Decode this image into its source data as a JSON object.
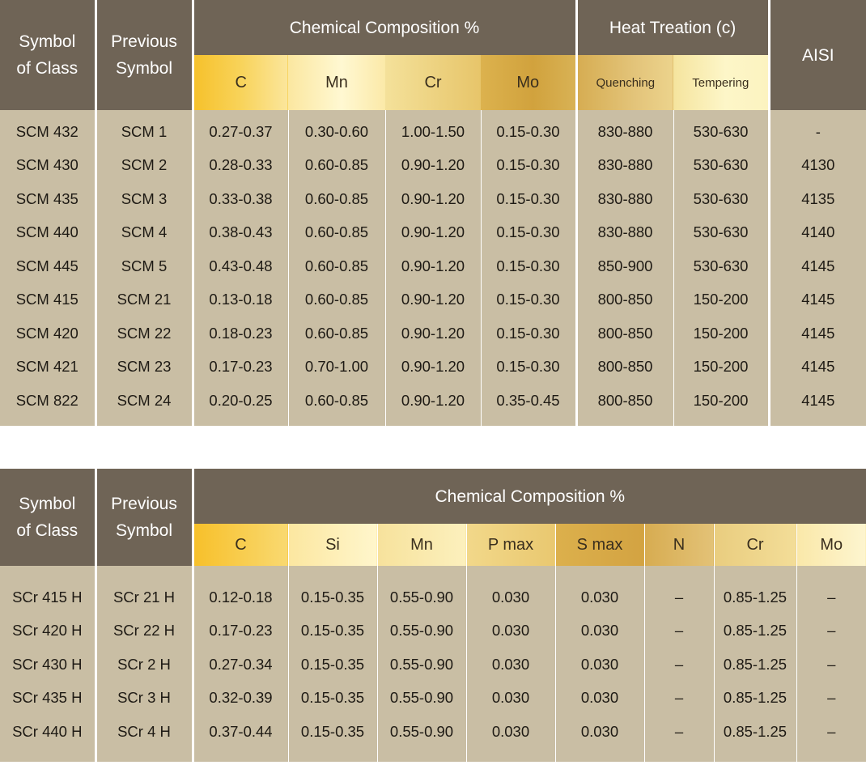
{
  "table1": {
    "headers": {
      "symbol_of_class": [
        "Symbol",
        "of Class"
      ],
      "previous_symbol": [
        "Previous",
        "Symbol"
      ],
      "chemical_composition": "Chemical Composition %",
      "heat_treation": "Heat Treation (c)",
      "aisi": "AISI",
      "sub": [
        "C",
        "Mn",
        "Cr",
        "Mo",
        "Quenching",
        "Tempering"
      ]
    },
    "rows": [
      [
        "SCM 432",
        "SCM 1",
        "0.27-0.37",
        "0.30-0.60",
        "1.00-1.50",
        "0.15-0.30",
        "830-880",
        "530-630",
        "-"
      ],
      [
        "SCM 430",
        "SCM 2",
        "0.28-0.33",
        "0.60-0.85",
        "0.90-1.20",
        "0.15-0.30",
        "830-880",
        "530-630",
        "4130"
      ],
      [
        "SCM 435",
        "SCM 3",
        "0.33-0.38",
        "0.60-0.85",
        "0.90-1.20",
        "0.15-0.30",
        "830-880",
        "530-630",
        "4135"
      ],
      [
        "SCM 440",
        "SCM 4",
        "0.38-0.43",
        "0.60-0.85",
        "0.90-1.20",
        "0.15-0.30",
        "830-880",
        "530-630",
        "4140"
      ],
      [
        "SCM 445",
        "SCM 5",
        "0.43-0.48",
        "0.60-0.85",
        "0.90-1.20",
        "0.15-0.30",
        "850-900",
        "530-630",
        "4145"
      ],
      [
        "SCM 415",
        "SCM 21",
        "0.13-0.18",
        "0.60-0.85",
        "0.90-1.20",
        "0.15-0.30",
        "800-850",
        "150-200",
        "4145"
      ],
      [
        "SCM 420",
        "SCM 22",
        "0.18-0.23",
        "0.60-0.85",
        "0.90-1.20",
        "0.15-0.30",
        "800-850",
        "150-200",
        "4145"
      ],
      [
        "SCM 421",
        "SCM 23",
        "0.17-0.23",
        "0.70-1.00",
        "0.90-1.20",
        "0.15-0.30",
        "800-850",
        "150-200",
        "4145"
      ],
      [
        "SCM 822",
        "SCM 24",
        "0.20-0.25",
        "0.60-0.85",
        "0.90-1.20",
        "0.35-0.45",
        "800-850",
        "150-200",
        "4145"
      ]
    ]
  },
  "table2": {
    "headers": {
      "symbol_of_class": [
        "Symbol",
        "of Class"
      ],
      "previous_symbol": [
        "Previous",
        "Symbol"
      ],
      "chemical_composition": "Chemical Composition %",
      "sub": [
        "C",
        "Si",
        "Mn",
        "P max",
        "S max",
        "N",
        "Cr",
        "Mo"
      ]
    },
    "rows": [
      [
        "SCr 415 H",
        "SCr 21 H",
        "0.12-0.18",
        "0.15-0.35",
        "0.55-0.90",
        "0.030",
        "0.030",
        "–",
        "0.85-1.25",
        "–"
      ],
      [
        "SCr 420 H",
        "SCr 22 H",
        "0.17-0.23",
        "0.15-0.35",
        "0.55-0.90",
        "0.030",
        "0.030",
        "–",
        "0.85-1.25",
        "–"
      ],
      [
        "SCr 430 H",
        "SCr 2 H",
        "0.27-0.34",
        "0.15-0.35",
        "0.55-0.90",
        "0.030",
        "0.030",
        "–",
        "0.85-1.25",
        "–"
      ],
      [
        "SCr 435 H",
        "SCr 3 H",
        "0.32-0.39",
        "0.15-0.35",
        "0.55-0.90",
        "0.030",
        "0.030",
        "–",
        "0.85-1.25",
        "–"
      ],
      [
        "SCr 440 H",
        "SCr 4 H",
        "0.37-0.44",
        "0.15-0.35",
        "0.55-0.90",
        "0.030",
        "0.030",
        "–",
        "0.85-1.25",
        "–"
      ]
    ]
  }
}
